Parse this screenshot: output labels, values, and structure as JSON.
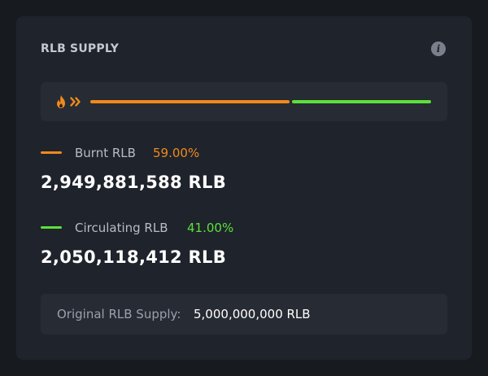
{
  "card": {
    "title": "RLB SUPPLY",
    "info_icon": "info-icon",
    "info_glyph": "i"
  },
  "progress": {
    "icons": [
      "flame-icon",
      "double-chevron-right-icon"
    ],
    "burnt_fraction": 0.59,
    "circulating_fraction": 0.41,
    "colors": {
      "burnt": "#f08a1c",
      "circulating": "#5be13a"
    }
  },
  "burnt": {
    "label": "Burnt RLB",
    "percent": "59.00%",
    "amount": "2,949,881,588 RLB",
    "color": "#f08a1c"
  },
  "circulating": {
    "label": "Circulating RLB",
    "percent": "41.00%",
    "amount": "2,050,118,412 RLB",
    "color": "#5be13a"
  },
  "original": {
    "label": "Original RLB Supply:",
    "value": "5,000,000,000 RLB"
  }
}
